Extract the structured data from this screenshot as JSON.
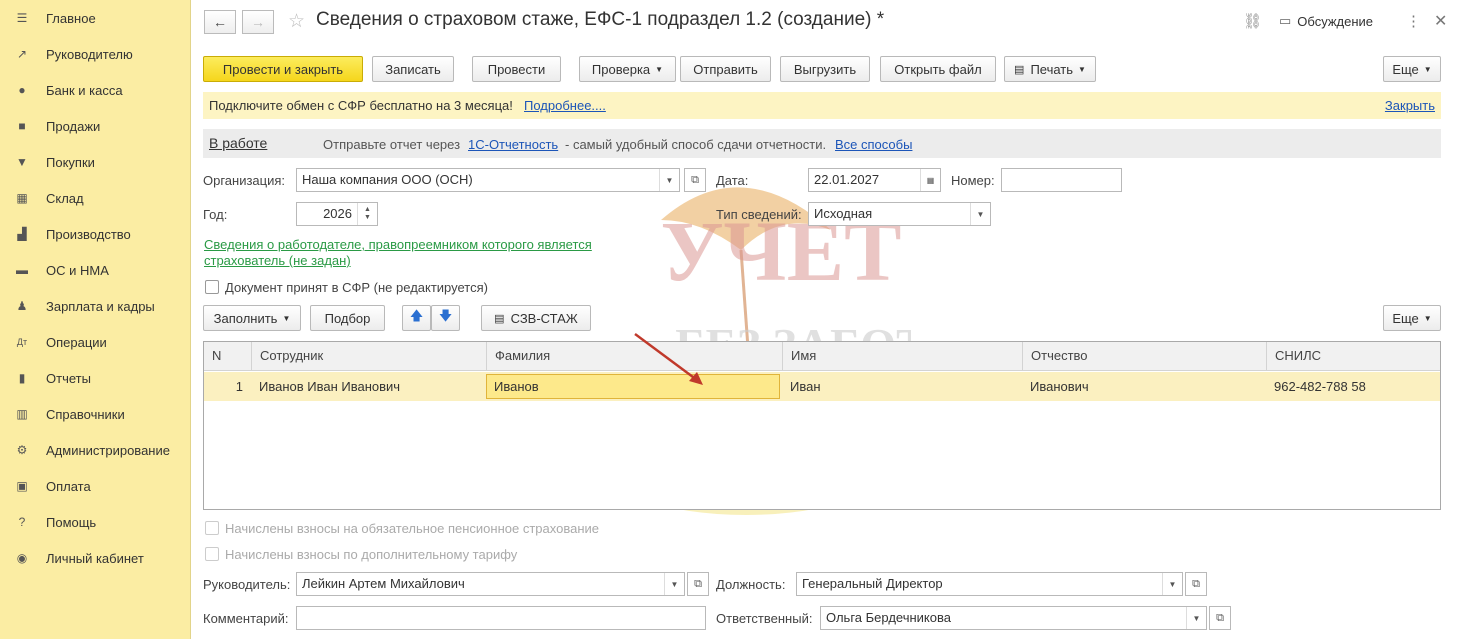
{
  "sidebar": {
    "items": [
      {
        "icon": "menu-icon",
        "label": "Главное"
      },
      {
        "icon": "trend-icon",
        "label": "Руководителю"
      },
      {
        "icon": "coin-icon",
        "label": "Банк и касса"
      },
      {
        "icon": "bag-icon",
        "label": "Продажи"
      },
      {
        "icon": "cart-icon",
        "label": "Покупки"
      },
      {
        "icon": "warehouse-icon",
        "label": "Склад"
      },
      {
        "icon": "factory-icon",
        "label": "Производство"
      },
      {
        "icon": "truck-icon",
        "label": "ОС и НМА"
      },
      {
        "icon": "person-icon",
        "label": "Зарплата и кадры"
      },
      {
        "icon": "operations-icon",
        "label": "Операции"
      },
      {
        "icon": "bar-chart-icon",
        "label": "Отчеты"
      },
      {
        "icon": "books-icon",
        "label": "Справочники"
      },
      {
        "icon": "gear-icon",
        "label": "Администрирование"
      },
      {
        "icon": "wallet-icon",
        "label": "Оплата"
      },
      {
        "icon": "question-icon",
        "label": "Помощь"
      },
      {
        "icon": "user-circle-icon",
        "label": "Личный кабинет"
      }
    ]
  },
  "header": {
    "title": "Сведения о страховом стаже, ЕФС-1 подраздел 1.2 (создание) *",
    "discussion": "Обсуждение"
  },
  "toolbar": {
    "post_close": "Провести и закрыть",
    "save": "Записать",
    "post": "Провести",
    "check": "Проверка",
    "send": "Отправить",
    "upload": "Выгрузить",
    "open_file": "Открыть файл",
    "print": "Печать",
    "more": "Еще"
  },
  "banner": {
    "text": "Подключите обмен с СФР бесплатно на 3 месяца!",
    "more_link": "Подробнее....",
    "close_link": "Закрыть"
  },
  "status": {
    "state": "В работе",
    "hint_prefix": "Отправьте отчет через",
    "hint_link": "1С-Отчетность",
    "hint_suffix": "- самый удобный способ сдачи отчетности.",
    "all_ways": "Все способы"
  },
  "form": {
    "org_label": "Организация:",
    "org_value": "Наша компания ООО (ОСН)",
    "date_label": "Дата:",
    "date_value": "22.01.2027",
    "number_label": "Номер:",
    "number_value": "",
    "year_label": "Год:",
    "year_value": "2026",
    "type_label": "Тип сведений:",
    "type_value": "Исходная",
    "employer_link_line1": "Сведения о работодателе, правопреемником которого является",
    "employer_link_line2": "страхователь (не задан)",
    "accepted_label": "Документ принят в СФР (не редактируется)"
  },
  "table_toolbar": {
    "fill": "Заполнить",
    "pick": "Подбор",
    "szv": "СЗВ-СТАЖ",
    "more": "Еще"
  },
  "table": {
    "columns": [
      "N",
      "Сотрудник",
      "Фамилия",
      "Имя",
      "Отчество",
      "СНИЛС"
    ],
    "rows": [
      {
        "n": "1",
        "employee": "Иванов Иван Иванович",
        "last": "Иванов",
        "first": "Иван",
        "middle": "Иванович",
        "snils": "962-482-788 58"
      }
    ]
  },
  "footer": {
    "pension_chk": "Начислены взносы на обязательное пенсионное страхование",
    "extra_chk": "Начислены взносы по дополнительному тарифу",
    "head_label": "Руководитель:",
    "head_value": "Лейкин Артем Михайлович",
    "position_label": "Должность:",
    "position_value": "Генеральный Директор",
    "comment_label": "Комментарий:",
    "comment_value": "",
    "responsible_label": "Ответственный:",
    "responsible_value": "Ольга Бердечникова"
  },
  "watermark": {
    "line1": "УЧЕТ",
    "line2": "БЕЗ ЗАБОТ"
  },
  "colors": {
    "sidebar_bg": "#fbeda3",
    "primary_btn": "#f5d61c",
    "link": "#1c55b8",
    "green_link": "#2a9a45",
    "row_highlight": "#fbf0c0"
  }
}
